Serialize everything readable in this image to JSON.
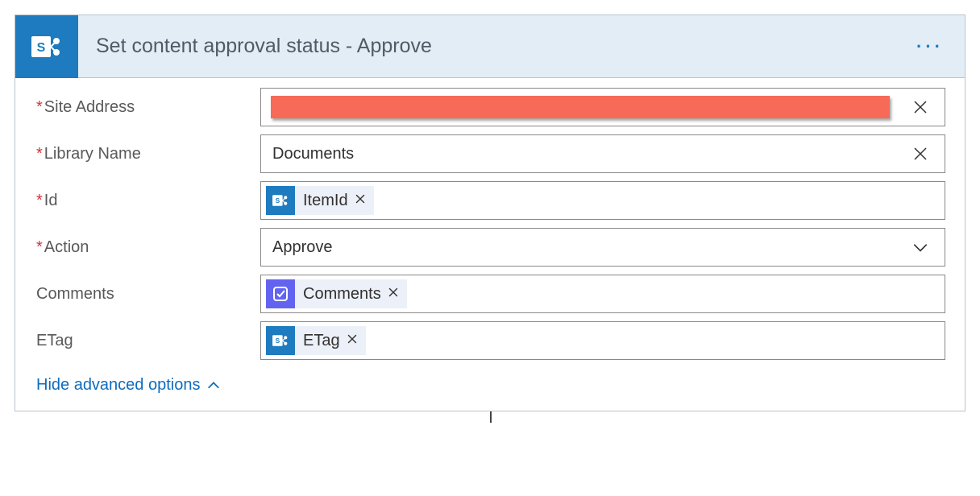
{
  "header": {
    "title": "Set content approval status - Approve"
  },
  "fields": {
    "siteAddress": {
      "label": "Site Address",
      "required": true
    },
    "libraryName": {
      "label": "Library Name",
      "required": true,
      "value": "Documents"
    },
    "id": {
      "label": "Id",
      "required": true,
      "token": "ItemId"
    },
    "action": {
      "label": "Action",
      "required": true,
      "value": "Approve"
    },
    "comments": {
      "label": "Comments",
      "required": false,
      "token": "Comments"
    },
    "etag": {
      "label": "ETag",
      "required": false,
      "token": "ETag"
    }
  },
  "advancedToggle": "Hide advanced options"
}
